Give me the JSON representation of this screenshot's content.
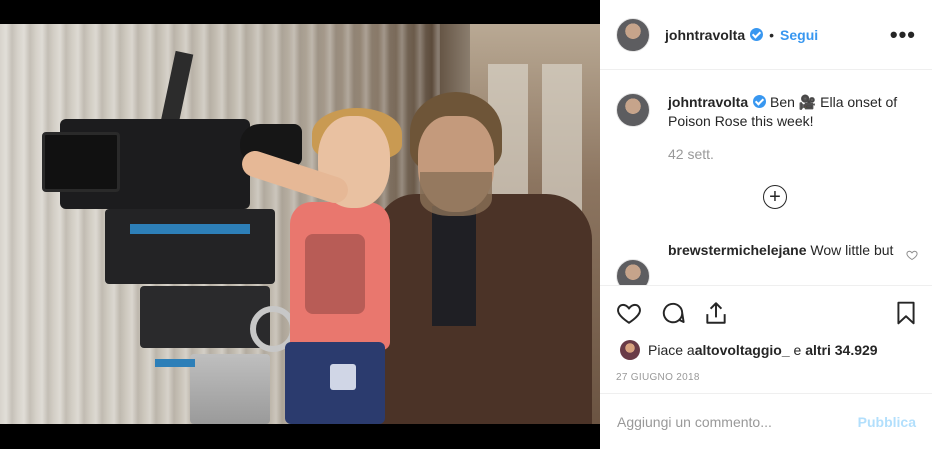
{
  "post": {
    "photo_alt": "Photo",
    "username": "johntravolta",
    "verified": true,
    "separator": "•",
    "follow_label": "Segui",
    "more_label": "•••"
  },
  "caption": {
    "username": "johntravolta",
    "text": " Ben 🎥 Ella onset of Poison Rose this week!",
    "time": "42 sett."
  },
  "load_more_symbol": "+",
  "comments": [
    {
      "username": "brewstermichelejane",
      "text": " Wow little but"
    }
  ],
  "likes": {
    "prefix": "Piace a ",
    "user": "altovoltaggio_",
    "middle": " e ",
    "count": "altri 34.929"
  },
  "date": "27 GIUGNO 2018",
  "add_comment": {
    "placeholder": "Aggiungi un commento...",
    "publish_label": "Pubblica"
  },
  "colors": {
    "accent": "#3897f0",
    "publish_disabled": "#b2dffc",
    "muted": "#999999"
  }
}
